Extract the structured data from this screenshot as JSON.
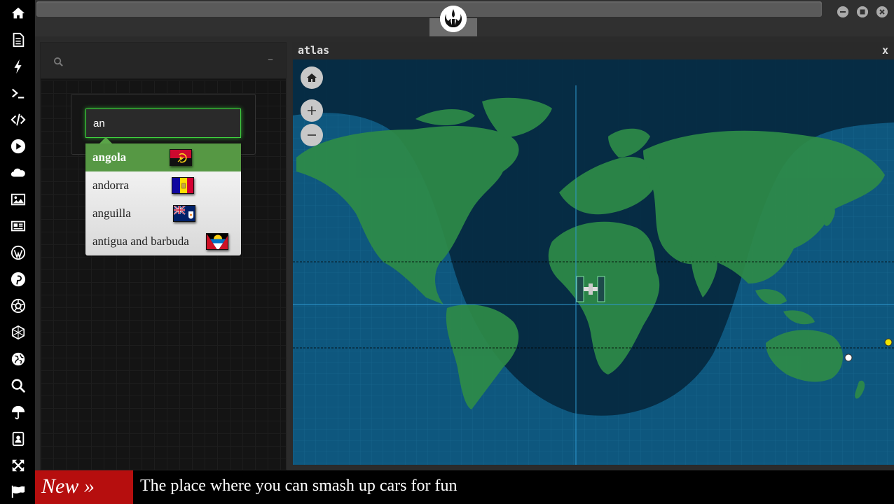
{
  "sidebar": {
    "items": [
      {
        "icon": "home-icon"
      },
      {
        "icon": "document-icon"
      },
      {
        "icon": "lightning-icon"
      },
      {
        "icon": "terminal-icon"
      },
      {
        "icon": "code-icon"
      },
      {
        "icon": "play-icon"
      },
      {
        "icon": "cloud-icon"
      },
      {
        "icon": "image-icon"
      },
      {
        "icon": "newspaper-icon"
      },
      {
        "icon": "wordpress-icon"
      },
      {
        "icon": "pinterest-icon"
      },
      {
        "icon": "aperture-icon"
      },
      {
        "icon": "globe-mesh-icon"
      },
      {
        "icon": "globe-icon"
      },
      {
        "icon": "search-icon"
      },
      {
        "icon": "umbrella-icon"
      },
      {
        "icon": "contacts-icon"
      },
      {
        "icon": "expand-icon"
      },
      {
        "icon": "flag-icon"
      }
    ]
  },
  "search_panel": {
    "collapse_label": "–",
    "input_value": "an",
    "suggestions": [
      {
        "label": "angola",
        "flag": "angola-flag"
      },
      {
        "label": "andorra",
        "flag": "andorra-flag"
      },
      {
        "label": "anguilla",
        "flag": "anguilla-flag"
      },
      {
        "label": "antigua and barbuda",
        "flag": "antigua-and-barbuda-flag"
      }
    ]
  },
  "atlas": {
    "title": "atlas",
    "close_label": "x"
  },
  "news": {
    "badge": "New »",
    "headline": "The place where you can smash up cars for fun"
  },
  "colors": {
    "accent_green": "#3fd43f",
    "selected_green": "#569844",
    "ocean": "#0e577e",
    "land": "#2e8b48",
    "badge_red": "#b60e0e"
  }
}
